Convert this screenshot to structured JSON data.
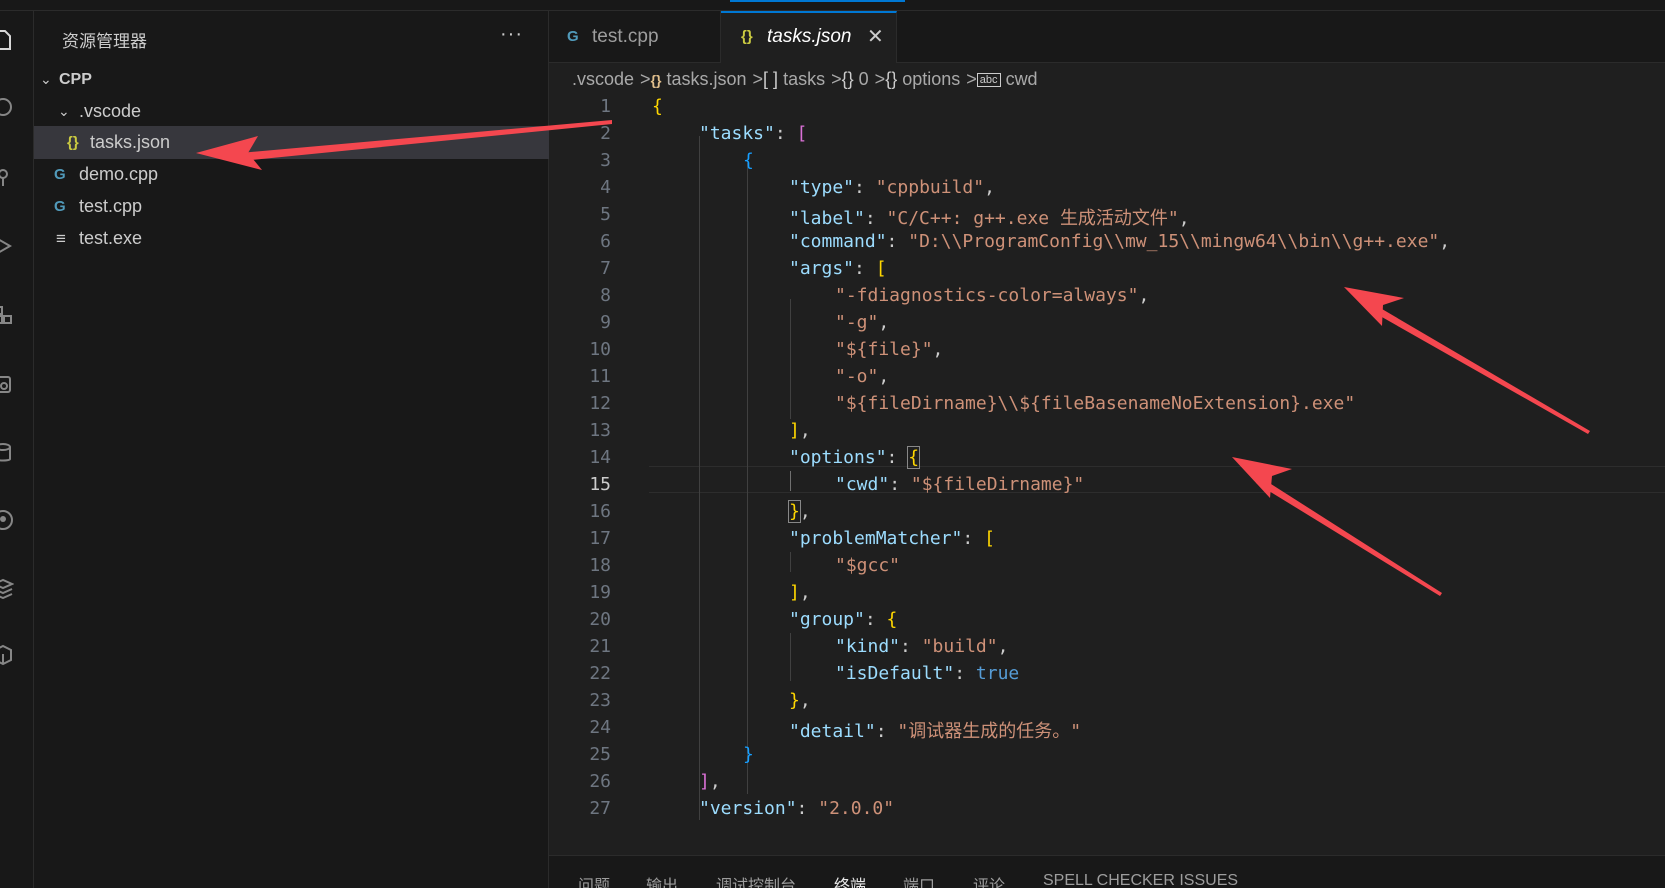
{
  "sidebar": {
    "title": "资源管理器",
    "more": "···",
    "tree": [
      {
        "label": "CPP",
        "icon": "",
        "type": "folder-root"
      },
      {
        "label": ".vscode",
        "icon": "",
        "type": "folder"
      },
      {
        "label": "tasks.json",
        "icon": "{}",
        "type": "json",
        "selected": true
      },
      {
        "label": "demo.cpp",
        "icon": "G",
        "type": "cpp"
      },
      {
        "label": "test.cpp",
        "icon": "G",
        "type": "cpp"
      },
      {
        "label": "test.exe",
        "icon": "≡",
        "type": "exe"
      }
    ]
  },
  "tabs": [
    {
      "label": "test.cpp",
      "icon": "G",
      "active": false
    },
    {
      "label": "tasks.json",
      "icon": "{}",
      "active": true,
      "close": "✕"
    }
  ],
  "breadcrumb": {
    "items": [
      ".vscode",
      "tasks.json",
      "tasks",
      "0",
      "options",
      "cwd"
    ],
    "icons": [
      "",
      "{}",
      "[ ]",
      "{}",
      "{}",
      "abc"
    ],
    "separator": ">"
  },
  "editor": {
    "current_line": 15,
    "line_numbers": [
      "1",
      "2",
      "3",
      "4",
      "5",
      "6",
      "7",
      "8",
      "9",
      "10",
      "11",
      "12",
      "13",
      "14",
      "15",
      "16",
      "17",
      "18",
      "19",
      "20",
      "21",
      "22",
      "23",
      "24",
      "25",
      "26",
      "27"
    ],
    "lines": {
      "l1_open": "{",
      "l2_key": "\"tasks\"",
      "l2_colon": ": ",
      "l2_open": "[",
      "l3_open": "{",
      "l4_key": "\"type\"",
      "l4_colon": ": ",
      "l4_val": "\"cppbuild\"",
      "l4_comma": ",",
      "l5_key": "\"label\"",
      "l5_colon": ": ",
      "l5_val": "\"C/C++: g++.exe 生成活动文件\"",
      "l5_comma": ",",
      "l6_key": "\"command\"",
      "l6_colon": ": ",
      "l6_val": "\"D:\\\\ProgramConfig\\\\mw_15\\\\mingw64\\\\bin\\\\g++.exe\"",
      "l6_comma": ",",
      "l7_key": "\"args\"",
      "l7_colon": ": ",
      "l7_open": "[",
      "l8_val": "\"-fdiagnostics-color=always\"",
      "l8_comma": ",",
      "l9_val": "\"-g\"",
      "l9_comma": ",",
      "l10_val": "\"${file}\"",
      "l10_comma": ",",
      "l11_val": "\"-o\"",
      "l11_comma": ",",
      "l12_val": "\"${fileDirname}\\\\${fileBasenameNoExtension}.exe\"",
      "l13_close": "]",
      "l13_comma": ",",
      "l14_key": "\"options\"",
      "l14_colon": ": ",
      "l14_open": "{",
      "l15_key": "\"cwd\"",
      "l15_colon": ": ",
      "l15_val": "\"${fileDirname}\"",
      "l16_close": "}",
      "l16_comma": ",",
      "l17_key": "\"problemMatcher\"",
      "l17_colon": ": ",
      "l17_open": "[",
      "l18_val": "\"$gcc\"",
      "l19_close": "]",
      "l19_comma": ",",
      "l20_key": "\"group\"",
      "l20_colon": ": ",
      "l20_open": "{",
      "l21_key": "\"kind\"",
      "l21_colon": ": ",
      "l21_val": "\"build\"",
      "l21_comma": ",",
      "l22_key": "\"isDefault\"",
      "l22_colon": ": ",
      "l22_val": "true",
      "l23_close": "}",
      "l23_comma": ",",
      "l24_key": "\"detail\"",
      "l24_colon": ": ",
      "l24_val": "\"调试器生成的任务。\"",
      "l25_close": "}",
      "l26_close": "]",
      "l26_comma": ",",
      "l27_key": "\"version\"",
      "l27_colon": ": ",
      "l27_val": "\"2.0.0\""
    }
  },
  "panel": {
    "tabs": [
      "问题",
      "输出",
      "调试控制台",
      "终端",
      "端口",
      "评论",
      "SPELL CHECKER ISSUES"
    ],
    "active": "终端"
  },
  "colors": {
    "accent": "#0078d4",
    "annotation_arrow": "#f4474f",
    "json_key": "#9cdcfe",
    "json_string": "#ce9178",
    "json_keyword": "#569cd6"
  }
}
